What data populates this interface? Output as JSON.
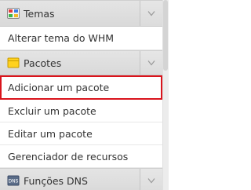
{
  "sections": [
    {
      "title": "Temas",
      "icon": "themes-icon",
      "items": [
        {
          "label": "Alterar tema do WHM"
        }
      ]
    },
    {
      "title": "Pacotes",
      "icon": "packages-icon",
      "items": [
        {
          "label": "Adicionar um pacote",
          "highlighted": true
        },
        {
          "label": "Excluir um pacote"
        },
        {
          "label": "Editar um pacote"
        },
        {
          "label": "Gerenciador de recursos"
        }
      ]
    },
    {
      "title": "Funções DNS",
      "icon": "dns-icon",
      "items": []
    }
  ],
  "colors": {
    "highlight_border": "#d9141c",
    "header_bg": "#dddddd",
    "text": "#333333"
  }
}
